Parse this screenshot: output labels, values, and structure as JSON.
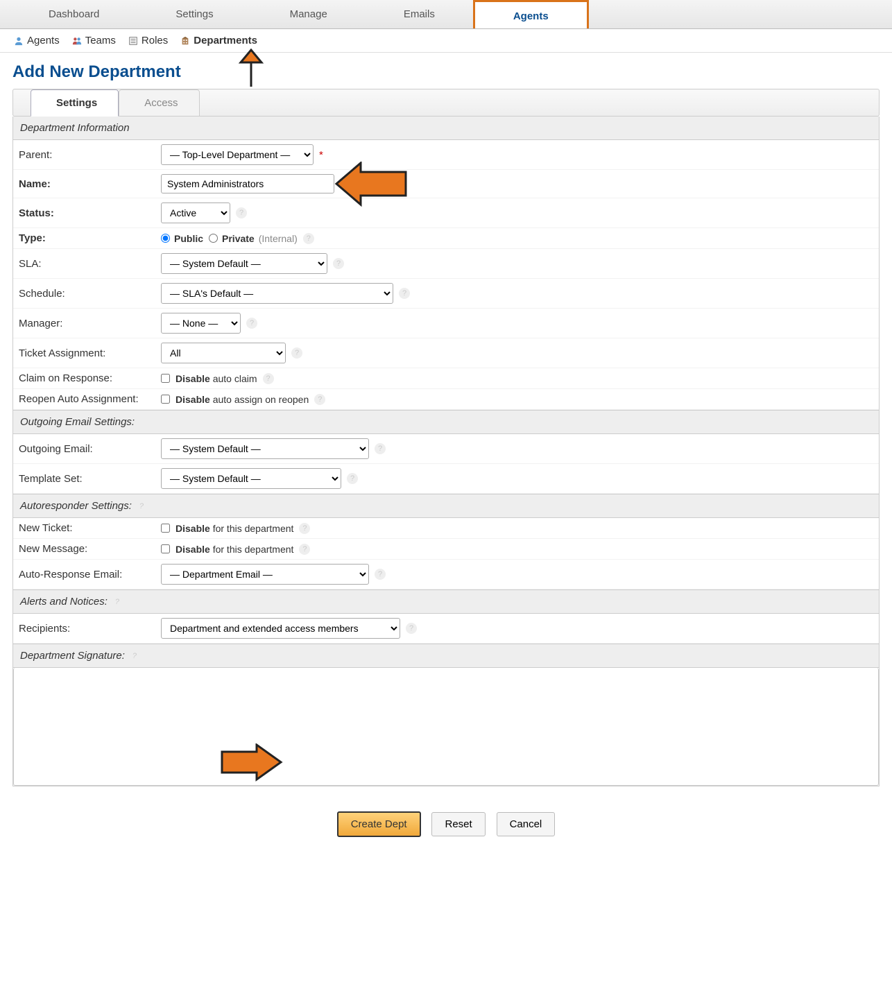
{
  "top_nav": {
    "dashboard": "Dashboard",
    "settings": "Settings",
    "manage": "Manage",
    "emails": "Emails",
    "agents": "Agents"
  },
  "sub_nav": {
    "agents": "Agents",
    "teams": "Teams",
    "roles": "Roles",
    "departments": "Departments"
  },
  "page_title": "Add New Department",
  "tabs": {
    "settings": "Settings",
    "access": "Access"
  },
  "sections": {
    "dept_info": "Department Information",
    "outgoing": "Outgoing Email Settings:",
    "autoresponder": "Autoresponder Settings:",
    "alerts": "Alerts and Notices:",
    "signature": "Department Signature:"
  },
  "fields": {
    "parent": {
      "label": "Parent:",
      "value": "— Top-Level Department —"
    },
    "name": {
      "label": "Name:",
      "value": "System Administrators"
    },
    "status": {
      "label": "Status:",
      "value": "Active"
    },
    "type": {
      "label": "Type:",
      "public": "Public",
      "private": "Private",
      "internal": "(Internal)"
    },
    "sla": {
      "label": "SLA:",
      "value": "— System Default —"
    },
    "schedule": {
      "label": "Schedule:",
      "value": "— SLA's Default —"
    },
    "manager": {
      "label": "Manager:",
      "value": "— None —"
    },
    "ticket_assignment": {
      "label": "Ticket Assignment:",
      "value": "All"
    },
    "claim": {
      "label": "Claim on Response:",
      "disable": "Disable",
      "text": " auto claim"
    },
    "reopen": {
      "label": "Reopen Auto Assignment:",
      "disable": "Disable",
      "text": " auto assign on reopen"
    },
    "outgoing_email": {
      "label": "Outgoing Email:",
      "value": "— System Default —"
    },
    "template_set": {
      "label": "Template Set:",
      "value": "— System Default —"
    },
    "new_ticket": {
      "label": "New Ticket:",
      "disable": "Disable",
      "text": " for this department"
    },
    "new_message": {
      "label": "New Message:",
      "disable": "Disable",
      "text": " for this department"
    },
    "auto_response_email": {
      "label": "Auto-Response Email:",
      "value": "— Department Email —"
    },
    "recipients": {
      "label": "Recipients:",
      "value": "Department and extended access members"
    }
  },
  "buttons": {
    "create": "Create Dept",
    "reset": "Reset",
    "cancel": "Cancel"
  }
}
